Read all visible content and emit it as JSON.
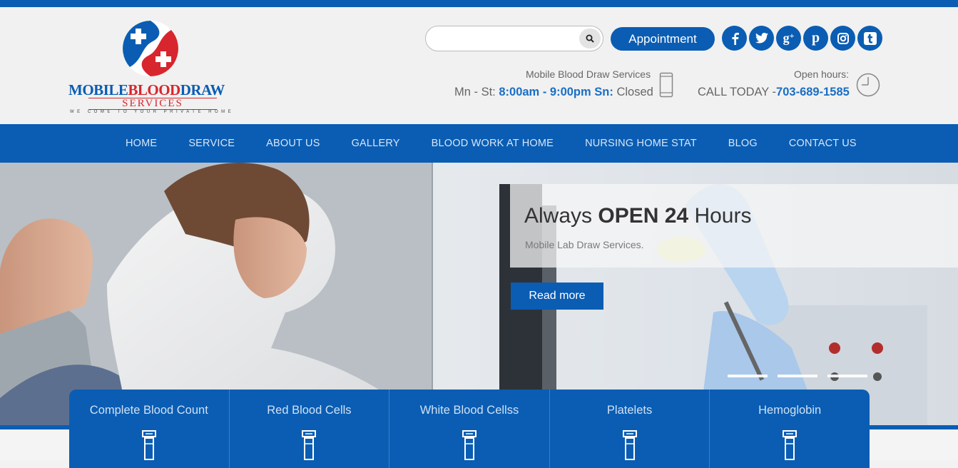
{
  "brand": {
    "word1": "MOBILE",
    "word2": "BLOOD",
    "word3": "DRAW",
    "sub": "SERVICES",
    "tagline": "WE COME TO YOUR PRIVATE HOME",
    "colors": {
      "blue": "#0a5db3",
      "red": "#d7262d"
    }
  },
  "search": {
    "placeholder": "",
    "value": "",
    "icon": "search-icon"
  },
  "appointment_label": "Appointment",
  "social": [
    {
      "name": "facebook-icon",
      "glyph": "f"
    },
    {
      "name": "twitter-icon",
      "glyph": "t"
    },
    {
      "name": "google-plus-icon",
      "glyph": "g+"
    },
    {
      "name": "pinterest-icon",
      "glyph": "p"
    },
    {
      "name": "instagram-icon",
      "glyph": "ig"
    },
    {
      "name": "tumblr-icon",
      "glyph": "t"
    }
  ],
  "hours_block": {
    "label": "Mobile Blood Draw Services",
    "prefix": "Mn - St:",
    "weekday_hours": "8:00am - 9:00pm",
    "sunday_label": "Sn:",
    "sunday_value": "Closed",
    "icon": "mobile-phone-icon"
  },
  "call_block": {
    "label": "Open hours:",
    "prefix": "CALL TODAY -",
    "phone": "703-689-1585",
    "icon": "clock-icon"
  },
  "nav": [
    "HOME",
    "SERVICE",
    "ABOUT US",
    "GALLERY",
    "BLOOD WORK AT HOME",
    "NURSING HOME STAT",
    "BLOG",
    "CONTACT US"
  ],
  "hero": {
    "title_pre": "Always",
    "title_bold": "OPEN 24",
    "title_post": "Hours",
    "subtitle": "Mobile Lab Draw Services.",
    "button": "Read more",
    "slides": 3
  },
  "tests": [
    "Complete Blood Count",
    "Red Blood Cells",
    "White Blood Cellss",
    "Platelets",
    "Hemoglobin"
  ]
}
